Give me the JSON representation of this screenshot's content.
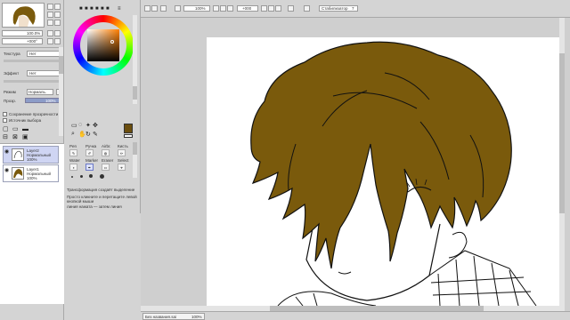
{
  "colors": {
    "hair": "#7a5a0c",
    "primary_color": "#6b4e0e",
    "canvas_bg": "#ffffff",
    "panel_bg": "#d4d4d4",
    "selected_layer": "#cfd5f3"
  },
  "toolbar": {
    "zoom_value": "100%",
    "angle_value": "+000",
    "stabilizer_label": "Стабилизатор",
    "stabilizer_value": "7"
  },
  "navigator": {
    "zoom": "100.0%",
    "angle": "+000°"
  },
  "layer_props": {
    "texture_label": "Текстура",
    "texture_value": "Нет",
    "effect_label": "Эффект",
    "effect_value": "Нет",
    "mode_label": "Режим",
    "mode_value": "Нормаль.",
    "opacity_label": "Прозр.",
    "opacity_value": "100%",
    "preserve_opacity": "Сохранение прозрачности",
    "clipping": "Источник выбора"
  },
  "layers": [
    {
      "name": "Layer2",
      "mode": "Нормальный",
      "opacity": "100%"
    },
    {
      "name": "Layer1",
      "mode": "Нормальный",
      "opacity": "100%"
    }
  ],
  "tools": {
    "labels": [
      "Pen",
      "Ручка",
      "Airbr.",
      "Кисть",
      "Water",
      "Marker",
      "Eraser",
      "Select",
      "Blend"
    ],
    "bottom_lines": [
      "Трансформация создаёт выделение",
      "Просто кликните и перетащите левой",
      "кнопкой мыши",
      "линия нажата — затем линия"
    ]
  },
  "status": {
    "tab_label": "Без названия.sai",
    "tab_zoom": "100%"
  }
}
